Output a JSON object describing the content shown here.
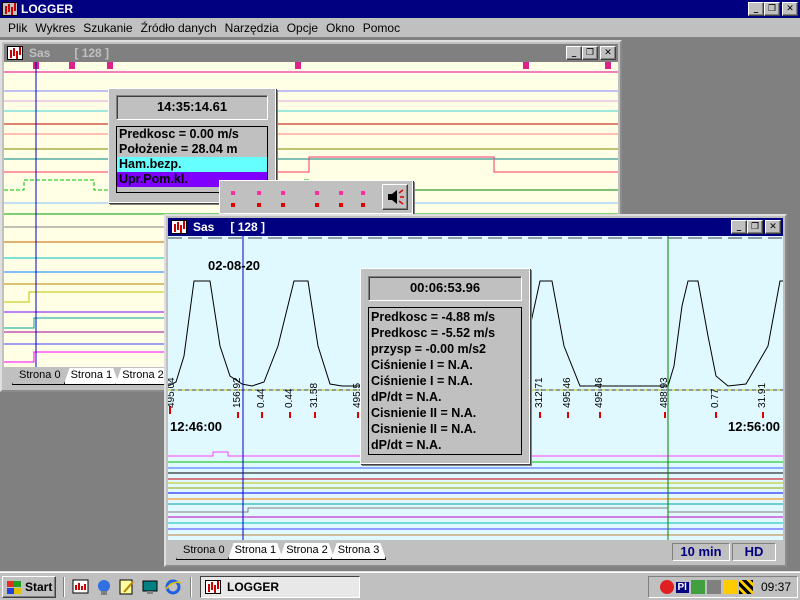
{
  "app": {
    "title": "LOGGER"
  },
  "titlebar_buttons": {
    "minimize": "_",
    "restore": "❐",
    "close": "✕"
  },
  "menu": [
    "Plik",
    "Wykres",
    "Szukanie",
    "Źródło danych",
    "Narzędzia",
    "Opcje",
    "Okno",
    "Pomoc"
  ],
  "window1": {
    "title": "Sas",
    "count": "[ 128 ]",
    "tabs": [
      "Strona 0",
      "Strona 1",
      "Strona 2"
    ],
    "active_tab": 0,
    "info": {
      "time": "14:35:14.61",
      "rows": [
        "Predkosc =    0.00 m/s",
        "Położenie =   28.04 m"
      ],
      "channels": [
        {
          "label": "Ham.bezp.",
          "bg": "#66ffff",
          "color": "#000000"
        },
        {
          "label": "Upr.Pom.kl.",
          "bg": "#8000ff",
          "color": "#000000"
        }
      ]
    }
  },
  "window2": {
    "title": "Sas",
    "count": "[ 128 ]",
    "date_label": "02-08-20",
    "time_left": "12:46:00",
    "time_right": "12:56:00",
    "tick_labels": [
      "495.04",
      "156.92",
      "0.44",
      "0.44",
      "31.58",
      "495.5",
      "312.71",
      "495.46",
      "495.46",
      "488.93",
      "0.77",
      "31.91"
    ],
    "tabs": [
      "Strona 0",
      "Strona 1",
      "Strona 2",
      "Strona 3"
    ],
    "active_tab": 0,
    "status": {
      "interval": "10 min",
      "mode": "HD"
    },
    "info": {
      "time": "00:06:53.96",
      "rows": [
        "Predkosc =  -4.88 m/s",
        "Predkosc =  -5.52 m/s",
        "przysp =  -0.00 m/s2",
        "Ciśnienie I = N.A.",
        "Ciśnienie I = N.A.",
        "dP/dt = N.A.",
        "Cisnienie II = N.A.",
        "Cisnienie II = N.A.",
        "dP/dt = N.A."
      ]
    }
  },
  "taskbar": {
    "start": "Start",
    "task": "LOGGER",
    "tray_lang": "Pl",
    "clock": "09:37"
  },
  "colors": {
    "active_title": "#000080",
    "inactive_title": "#808080",
    "plot1_bg": "#ffffe6",
    "plot2_bg": "#e0f8ff",
    "cursor_blue": "#0000cc",
    "cursor_green": "#008000"
  }
}
